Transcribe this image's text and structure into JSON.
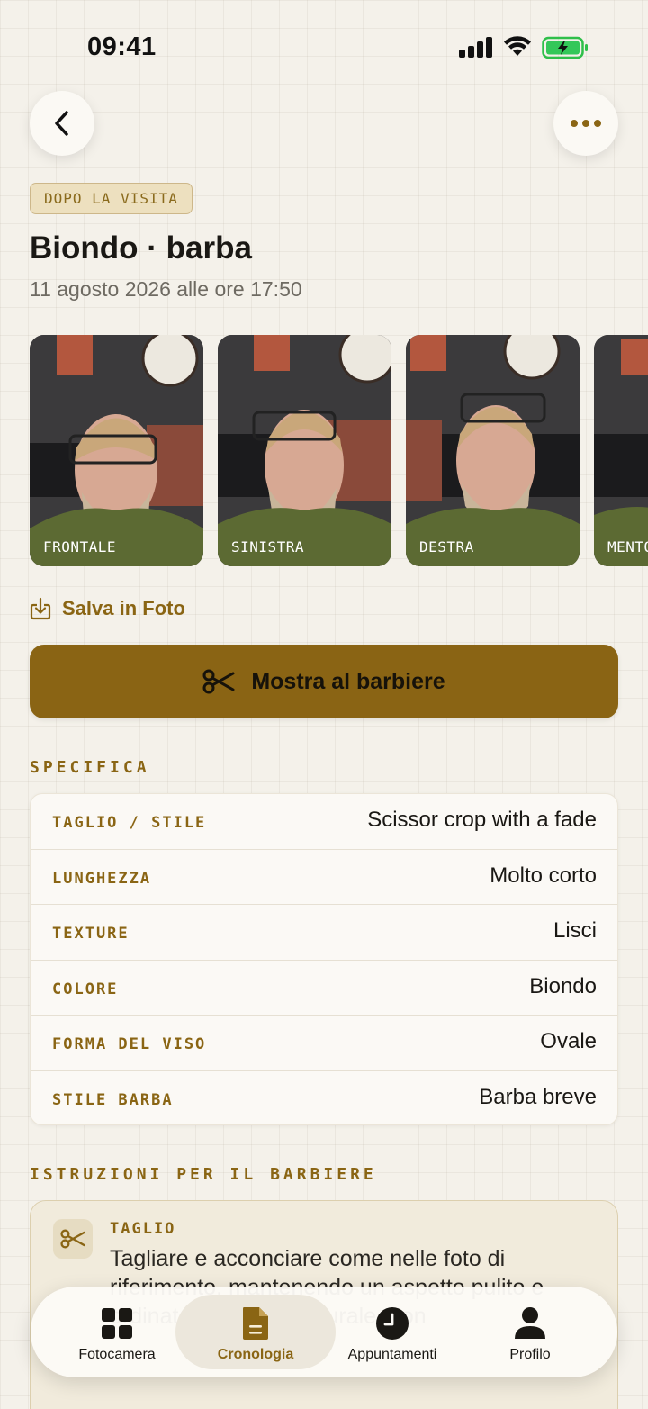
{
  "status_bar": {
    "time": "09:41"
  },
  "header": {
    "badge": "DOPO LA VISITA",
    "title": "Biondo · barba",
    "date": "11 agosto 2026 alle ore 17:50"
  },
  "photos": [
    {
      "label": "FRONTALE"
    },
    {
      "label": "SINISTRA"
    },
    {
      "label": "DESTRA"
    },
    {
      "label": "MENTO"
    }
  ],
  "actions": {
    "save_label": "Salva in Foto",
    "primary_label": "Mostra al barbiere"
  },
  "spec": {
    "section_title": "SPECIFICA",
    "rows": [
      {
        "key": "TAGLIO / STILE",
        "value": "Scissor crop with a fade"
      },
      {
        "key": "LUNGHEZZA",
        "value": "Molto corto"
      },
      {
        "key": "TEXTURE",
        "value": "Lisci"
      },
      {
        "key": "COLORE",
        "value": "Biondo"
      },
      {
        "key": "FORMA DEL VISO",
        "value": "Ovale"
      },
      {
        "key": "STILE BARBA",
        "value": "Barba breve"
      }
    ]
  },
  "instructions": {
    "section_title": "ISTRUZIONI PER IL BARBIERE",
    "kicker": "TAGLIO",
    "text": "Tagliare e acconciare come nelle foto di riferimento, mantenendo un aspetto pulito e ordinato. Lasciare naturale, non"
  },
  "tab_bar": {
    "tabs": [
      {
        "label": "Fotocamera",
        "icon": "grid-icon"
      },
      {
        "label": "Cronologia",
        "icon": "document-icon"
      },
      {
        "label": "Appuntamenti",
        "icon": "clock-icon"
      },
      {
        "label": "Profilo",
        "icon": "person-icon"
      }
    ],
    "active_index": 1
  },
  "colors": {
    "accent": "#8a6514",
    "button": "#8a6414",
    "background": "#f4f1ea"
  }
}
